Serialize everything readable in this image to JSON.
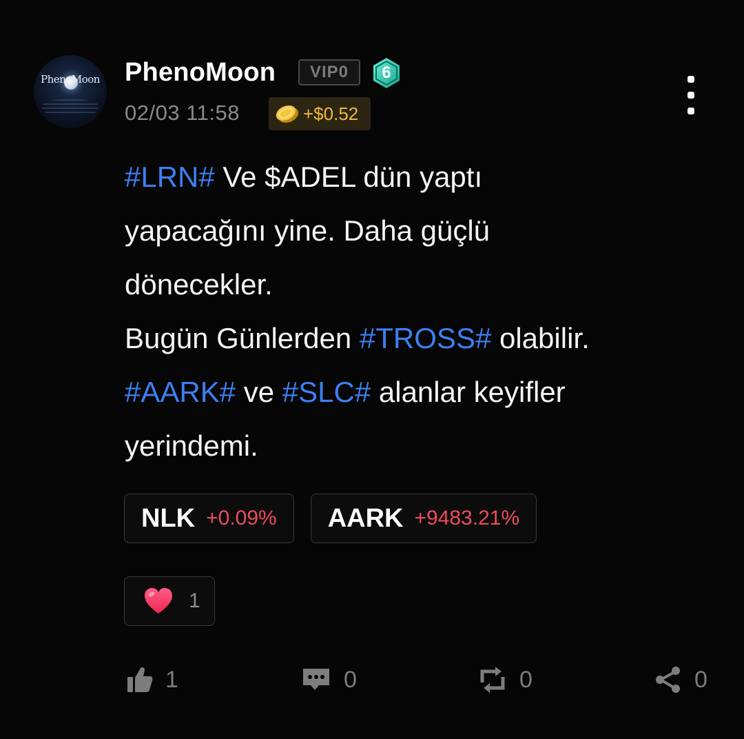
{
  "author": {
    "username": "PhenoMoon",
    "avatar_text": "PhenoMoon",
    "vip_label": "VIP0",
    "level": "6",
    "level_color": "#2dd4bf"
  },
  "meta": {
    "timestamp": "02/03 11:58",
    "reward_icon": "coin-icon",
    "reward_amount": "+$0.52",
    "reward_color": "#f2b83b"
  },
  "body": {
    "lines": [
      [
        {
          "text": "#LRN#",
          "tag": true
        },
        {
          "text": " Ve $ADEL dün yaptı",
          "tag": false
        }
      ],
      [
        {
          "text": "yapacağını yine. Daha güçlü",
          "tag": false
        }
      ],
      [
        {
          "text": "dönecekler.",
          "tag": false
        }
      ],
      [
        {
          "text": "Bugün Günlerden ",
          "tag": false
        },
        {
          "text": "#TROSS#",
          "tag": true
        },
        {
          "text": " olabilir.",
          "tag": false
        }
      ],
      [
        {
          "text": "#AARK#",
          "tag": true
        },
        {
          "text": " ve ",
          "tag": false
        },
        {
          "text": "#SLC#",
          "tag": true
        },
        {
          "text": " alanlar keyifler",
          "tag": false
        }
      ],
      [
        {
          "text": "yerindemi.",
          "tag": false
        }
      ]
    ],
    "tag_color": "#3d7ff2"
  },
  "stocks": [
    {
      "ticker": "NLK",
      "change": "+0.09%"
    },
    {
      "ticker": "AARK",
      "change": "+9483.21%"
    }
  ],
  "stock_change_color": "#ee4b5a",
  "reaction": {
    "icon": "heart-icon",
    "count": "1"
  },
  "actions": {
    "like": {
      "icon": "thumbs-up-icon",
      "count": "1"
    },
    "comment": {
      "icon": "comment-icon",
      "count": "0"
    },
    "repost": {
      "icon": "repost-icon",
      "count": "0"
    },
    "share": {
      "icon": "share-icon",
      "count": "0"
    }
  }
}
